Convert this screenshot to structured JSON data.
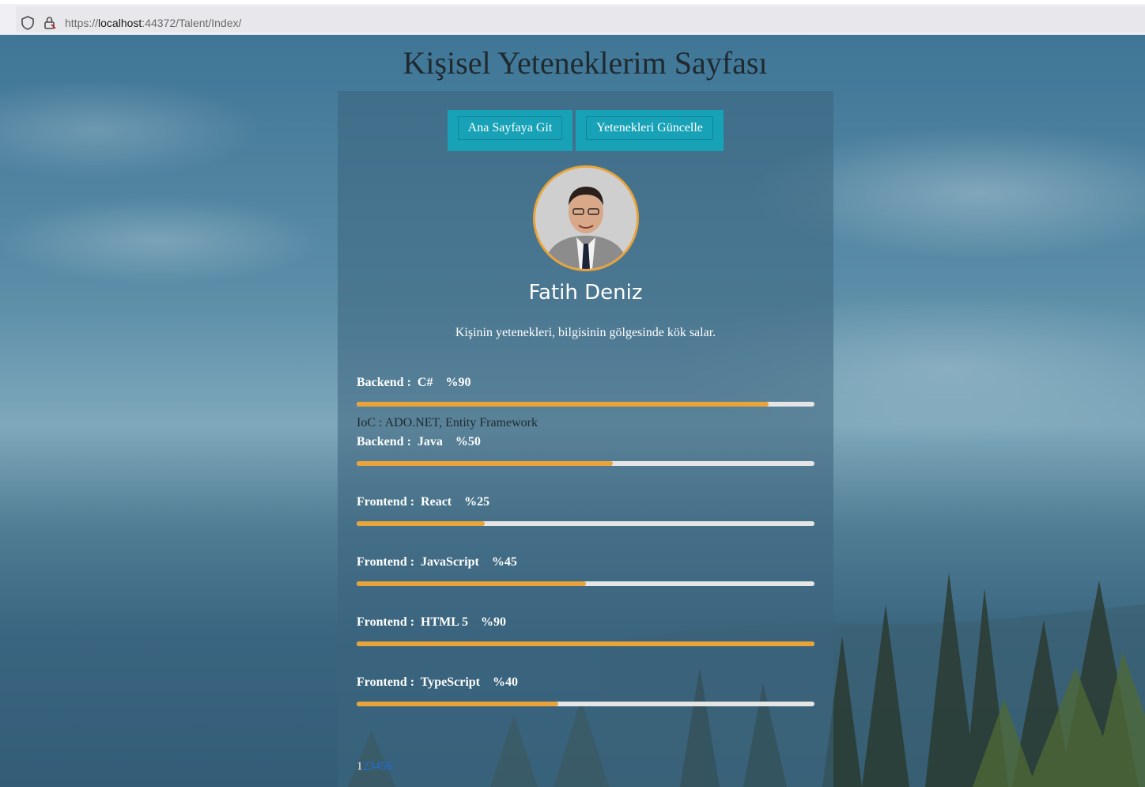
{
  "browser": {
    "url_prefix": "https://",
    "url_host": "localhost",
    "url_rest": ":44372/Talent/Index/"
  },
  "page": {
    "title": "Kişisel Yeteneklerim Sayfası",
    "buttons": {
      "home": "Ana Sayfaya Git",
      "update": "Yetenekleri Güncelle"
    },
    "profile": {
      "name": "Fatih Deniz",
      "quote": "Kişinin yetenekleri, bilgisinin gölgesinde kök salar."
    },
    "ioc_text": "IoC : ADO.NET, Entity Framework",
    "skills": [
      {
        "label": "Backend :  C#    %90",
        "percent": 90
      },
      {
        "label": "Backend :  Java    %50",
        "percent": 56
      },
      {
        "label": "Frontend :  React    %25",
        "percent": 28
      },
      {
        "label": "Frontend :  JavaScript    %45",
        "percent": 50
      },
      {
        "label": "Frontend :  HTML 5    %90",
        "percent": 100
      },
      {
        "label": "Frontend :  TypeScript    %40",
        "percent": 44
      }
    ],
    "pagination": {
      "current": "1",
      "pages": [
        "2",
        "3",
        "4",
        "5",
        "6"
      ]
    }
  },
  "colors": {
    "accent": "#e8a33a",
    "button": "#17a2b8",
    "link": "#1e6fd9"
  }
}
